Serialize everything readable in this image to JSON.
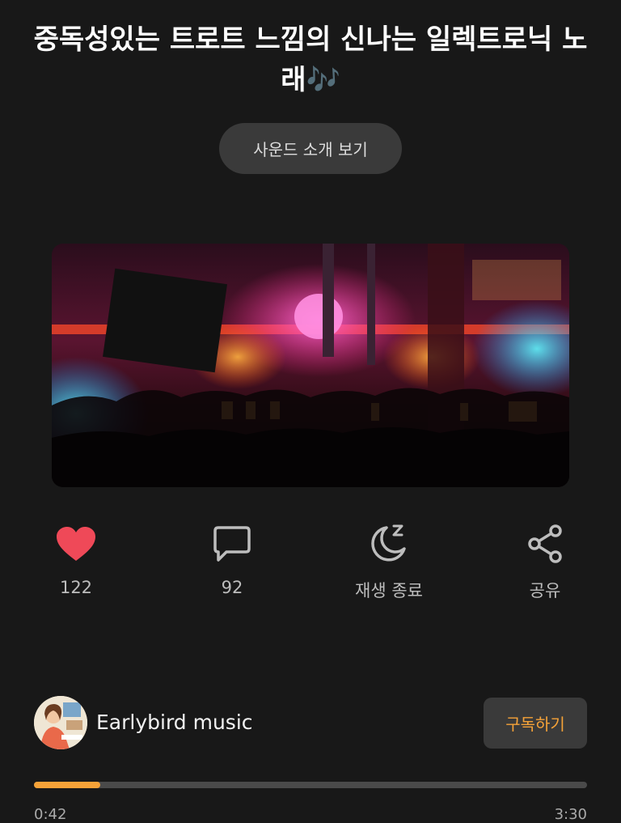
{
  "song": {
    "title": "중독성있는 트로트 느낌의 신나는 일렉트로닉 노래",
    "title_emoji": "🎶",
    "intro_button": "사운드 소개 보기"
  },
  "actions": {
    "like_count": "122",
    "comment_count": "92",
    "sleep_label": "재생 종료",
    "share_label": "공유"
  },
  "channel": {
    "name": "Earlybird music",
    "subscribe_label": "구독하기"
  },
  "player": {
    "progress": 0.12,
    "current_time": "0:42",
    "total_time": "3:30"
  },
  "colors": {
    "accent": "#f5a238",
    "heart": "#ef4958",
    "background": "#181818"
  }
}
